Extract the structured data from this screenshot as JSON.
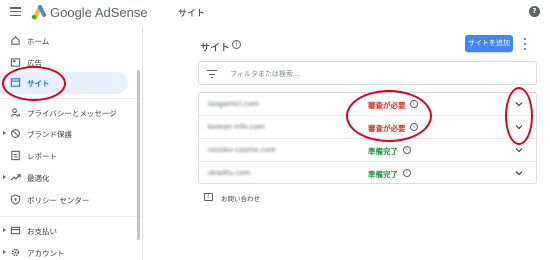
{
  "header": {
    "brand": "Google AdSense",
    "page_title": "サイト",
    "help_glyph": "?"
  },
  "sidebar": {
    "items": [
      {
        "label": "ホーム",
        "icon": "home-icon"
      },
      {
        "label": "広告",
        "icon": "ads-icon"
      },
      {
        "label": "サイト",
        "icon": "sites-icon",
        "active": true
      },
      {
        "label": "プライバシーとメッセージ",
        "icon": "privacy-messaging-icon"
      },
      {
        "label": "ブランド保護",
        "icon": "block-icon",
        "expandable": true
      },
      {
        "label": "レポート",
        "icon": "reports-icon"
      },
      {
        "label": "最適化",
        "icon": "trending-up-icon",
        "expandable": true
      },
      {
        "label": "ポリシー センター",
        "icon": "policy-shield-icon"
      },
      {
        "label": "お支払い",
        "icon": "payments-icon",
        "expandable": true
      },
      {
        "label": "アカウント",
        "icon": "account-gear-icon",
        "expandable": true
      }
    ]
  },
  "main": {
    "title": "サイト",
    "info_glyph": "i",
    "add_button": "サイトを追加",
    "filter_placeholder": "フィルタまたは検索...",
    "rows": [
      {
        "domain": "loogamici.com",
        "status": "審査が必要",
        "status_kind": "warn"
      },
      {
        "domain": "korean-info.com",
        "status": "審査が必要",
        "status_kind": "warn"
      },
      {
        "domain": "nozoko-cosme.com",
        "status": "準備完了",
        "status_kind": "ok"
      },
      {
        "domain": "okazitu.com",
        "status": "準備完了",
        "status_kind": "ok"
      }
    ],
    "feedback_label": "お問い合わせ",
    "feedback_glyph": "!"
  },
  "colors": {
    "accent": "#1a73e8",
    "button": "#4285f4",
    "warning": "#d93025",
    "ready": "#1e8e3e",
    "annotation": "#e0001b"
  }
}
